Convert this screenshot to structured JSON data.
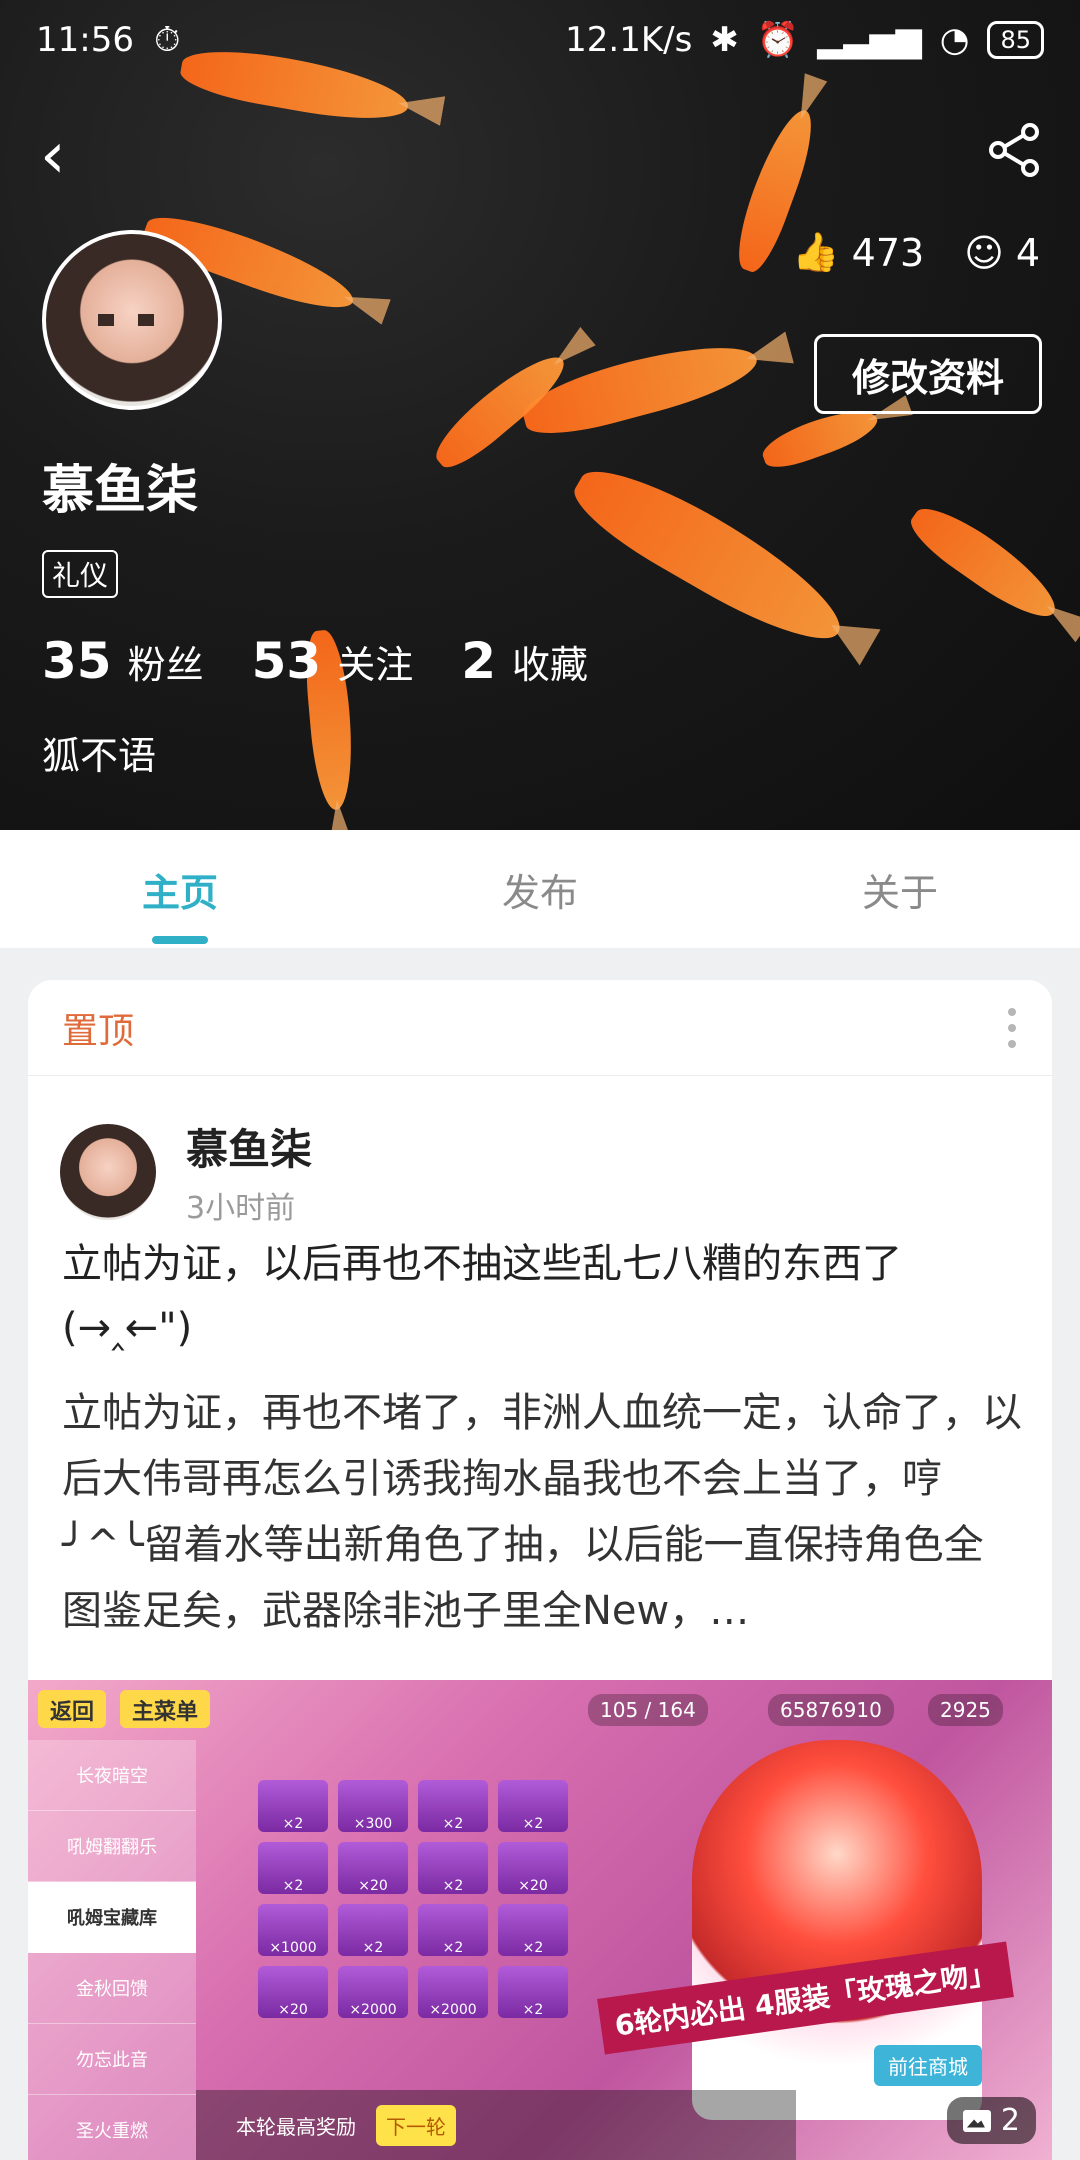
{
  "status_bar": {
    "time": "11:56",
    "network_speed": "12.1K/s",
    "battery": "85"
  },
  "header": {
    "likes": "473",
    "smiles": "4",
    "edit_label": "修改资料"
  },
  "profile": {
    "name": "慕鱼柒",
    "tag": "礼仪",
    "counts": [
      {
        "num": "35",
        "label": "粉丝"
      },
      {
        "num": "53",
        "label": "关注"
      },
      {
        "num": "2",
        "label": "收藏"
      }
    ],
    "bio": "狐不语"
  },
  "tabs": [
    {
      "label": "主页"
    },
    {
      "label": "发布"
    },
    {
      "label": "关于"
    }
  ],
  "card": {
    "pinned_label": "置顶",
    "author_name": "慕鱼柒",
    "time_ago": "3小时前",
    "title": "立帖为证，以后再也不抽这些乱七八糟的东西了(→‸←\")",
    "body": "立帖为证，再也不堵了，非洲人血统一定，认命了，以后大伟哥再怎么引诱我掏水晶我也不会上当了，哼╯^╰留着水等出新角色了抽，以后能一直保持角色全图鉴足矣，武器除非池子里全New，…",
    "image_count": "2",
    "game": {
      "back": "返回",
      "menu": "主菜单",
      "res1": "105 / 164",
      "res2": "65876910",
      "res3": "2925",
      "side": [
        "长夜暗空",
        "吼姆翻翻乐",
        "吼姆宝藏库",
        "金秋回馈",
        "勿忘此音",
        "圣火重燃"
      ],
      "grid": [
        "×2",
        "×300",
        "×2",
        "×2",
        "×2",
        "×20",
        "×2",
        "×20",
        "×1000",
        "×2",
        "×2",
        "×2",
        "×20",
        "×2000",
        "×2000",
        "×2"
      ],
      "banner": "6轮内必出 4服装「玫瑰之吻」",
      "go": "前往商城",
      "reward": "本轮最高奖励",
      "next": "下一轮"
    }
  }
}
